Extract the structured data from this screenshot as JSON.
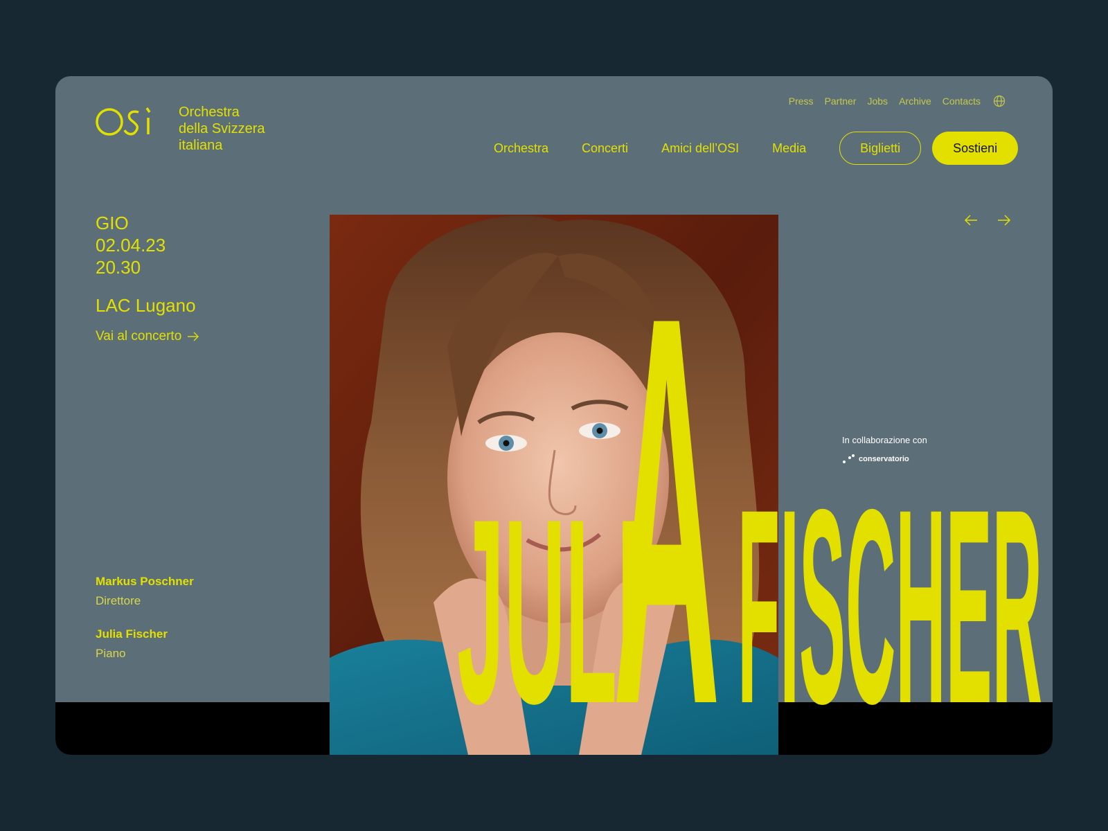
{
  "brand": {
    "mark": "OSI",
    "name_lines": [
      "Orchestra",
      "della Svizzera",
      "italiana"
    ],
    "accent": "#e3e000",
    "panel": "#5c6f79",
    "background": "#172833"
  },
  "utility_nav": [
    "Press",
    "Partner",
    "Jobs",
    "Archive",
    "Contacts"
  ],
  "language_icon": "globe-icon",
  "main_nav": [
    "Orchestra",
    "Concerti",
    "Amici dell’OSI",
    "Media"
  ],
  "buttons": {
    "tickets": "Biglietti",
    "support": "Sostieni"
  },
  "event": {
    "day": "GIO",
    "date": "02.04.23",
    "time": "20.30",
    "venue": "LAC Lugano",
    "cta": "Vai al concerto"
  },
  "artists": [
    {
      "name": "Markus Poschner",
      "role": "Direttore"
    },
    {
      "name": "Julia Fischer",
      "role": "Piano"
    }
  ],
  "headline": {
    "first": "JULI",
    "big_letter": "A",
    "last": "FISCHER"
  },
  "collaboration": {
    "label": "In collaborazione con",
    "partner": "conservatorio"
  },
  "carousel_icons": [
    "arrow-left-icon",
    "arrow-right-icon"
  ]
}
